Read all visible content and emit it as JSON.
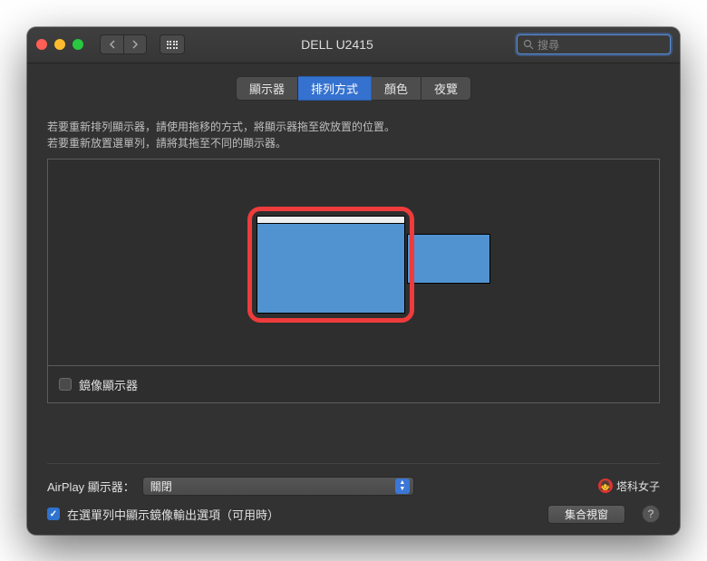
{
  "window": {
    "title": "DELL U2415"
  },
  "search": {
    "placeholder": "搜尋"
  },
  "tabs": [
    {
      "label": "顯示器",
      "active": false
    },
    {
      "label": "排列方式",
      "active": true
    },
    {
      "label": "顏色",
      "active": false
    },
    {
      "label": "夜覽",
      "active": false
    }
  ],
  "instructions": {
    "line1": "若要重新排列顯示器，請使用拖移的方式，將顯示器拖至欲放置的位置。",
    "line2": "若要重新放置選單列，請將其拖至不同的顯示器。"
  },
  "mirror": {
    "label": "鏡像顯示器",
    "checked": false
  },
  "airplay": {
    "label": "AirPlay 顯示器：",
    "value": "關閉"
  },
  "show_mirror_option": {
    "label": "在選單列中顯示鏡像輸出選項（可用時）",
    "checked": true
  },
  "gather": {
    "label": "集合視窗"
  },
  "help": {
    "label": "?"
  },
  "watermark": {
    "text": "塔科女子"
  }
}
